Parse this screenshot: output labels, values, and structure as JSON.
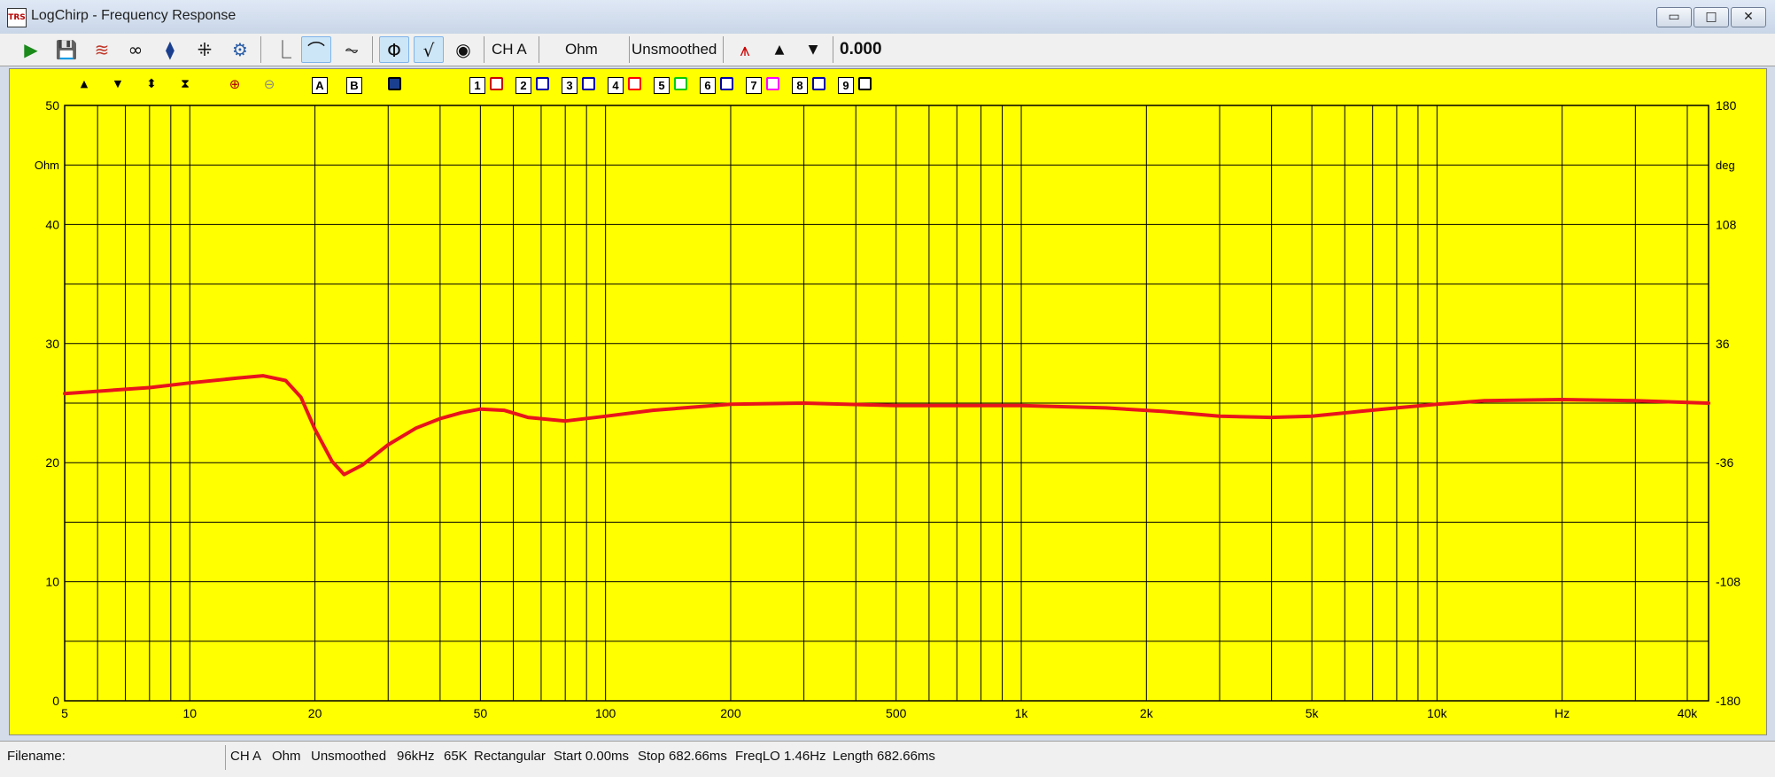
{
  "window": {
    "title": "LogChirp - Frequency Response",
    "icon_text": "TRS",
    "min": "▭",
    "max": "□",
    "close": "✕"
  },
  "toolbar": {
    "channel": "CH A",
    "unit": "Ohm",
    "smoothing": "Unsmoothed",
    "value": "0.000"
  },
  "plot_toolbar": {
    "a_label": "A",
    "b_label": "B",
    "numbers": [
      "1",
      "2",
      "3",
      "4",
      "5",
      "6",
      "7",
      "8",
      "9"
    ],
    "swatch_colors": [
      "#cc0000",
      "#0000aa",
      "#0000aa",
      "#ff0000",
      "#00cc00",
      "#0000aa",
      "#ff00ff",
      "#0000aa",
      "#000000"
    ]
  },
  "chart_data": {
    "type": "line",
    "background": "#ffff00",
    "grid": true,
    "x_scale": "log",
    "xlim": [
      5,
      45000
    ],
    "x_tick_labels": [
      "5",
      "10",
      "20",
      "50",
      "100",
      "200",
      "500",
      "1k",
      "2k",
      "5k",
      "10k",
      "Hz",
      "40k"
    ],
    "ylim": [
      0,
      50
    ],
    "ylabel": "Ohm",
    "y_tick_labels": [
      "50",
      "40",
      "30",
      "20",
      "10",
      "0"
    ],
    "y2_label": "deg",
    "y2lim": [
      -180,
      180
    ],
    "y2_tick_labels": [
      "180",
      "108",
      "36",
      "-36",
      "-108",
      "-180"
    ],
    "series": [
      {
        "color": "#e8141c",
        "x": [
          5,
          8,
          10,
          13,
          15,
          17,
          18.5,
          20,
          22,
          23.5,
          26,
          30,
          35,
          40,
          45,
          50,
          57,
          65,
          80,
          100,
          130,
          200,
          300,
          500,
          1000,
          1600,
          2200,
          3000,
          4000,
          5000,
          6500,
          8000,
          10000,
          13000,
          20000,
          30000,
          45000
        ],
        "y": [
          25.8,
          26.3,
          26.7,
          27.1,
          27.3,
          26.9,
          25.5,
          22.8,
          20.1,
          19.0,
          19.8,
          21.5,
          22.9,
          23.7,
          24.2,
          24.5,
          24.4,
          23.8,
          23.5,
          23.9,
          24.4,
          24.9,
          25.0,
          24.8,
          24.8,
          24.6,
          24.3,
          23.9,
          23.8,
          23.9,
          24.3,
          24.6,
          24.9,
          25.2,
          25.3,
          25.2,
          25.0
        ]
      }
    ]
  },
  "status": {
    "filename_label": "Filename:",
    "channel": "CH A",
    "unit": "Ohm",
    "smoothing": "Unsmoothed",
    "rate": "96kHz",
    "size": "65K",
    "window": "Rectangular",
    "start": "Start 0.00ms",
    "stop": "Stop 682.66ms",
    "freqlo": "FreqLO 1.46Hz",
    "length": "Length 682.66ms"
  }
}
